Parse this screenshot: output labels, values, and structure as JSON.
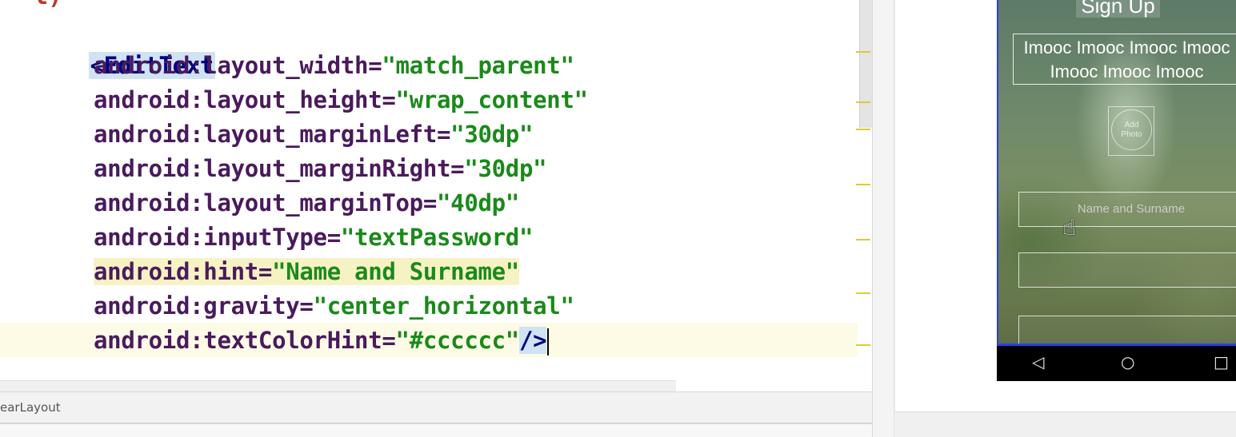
{
  "editor": {
    "partial_previous_line": "l)",
    "tag_open": "<EditText",
    "lines": [
      {
        "prefix": "android:",
        "name": "layout_width",
        "value": "\"match_parent\""
      },
      {
        "prefix": "android:",
        "name": "layout_height",
        "value": "\"wrap_content\""
      },
      {
        "prefix": "android:",
        "name": "layout_marginLeft",
        "value": "\"30dp\""
      },
      {
        "prefix": "android:",
        "name": "layout_marginRight",
        "value": "\"30dp\""
      },
      {
        "prefix": "android:",
        "name": "layout_marginTop",
        "value": "\"40dp\""
      },
      {
        "prefix": "android:",
        "name": "inputType",
        "value": "\"textPassword\""
      },
      {
        "prefix": "android:",
        "name": "hint",
        "value": "\"Name and Surname\""
      },
      {
        "prefix": "android:",
        "name": "gravity",
        "value": "\"center_horizontal\""
      },
      {
        "prefix": "android:",
        "name": "textColorHint",
        "value": "\"#cccccc\""
      }
    ],
    "tag_close": "/>",
    "breadcrumb": "earLayout"
  },
  "preview": {
    "title": "Sign Up",
    "mooc_line1": "Imooc Imooc Imooc Imooc",
    "mooc_line2": "Imooc Imooc Imooc",
    "photo_line1": "Add",
    "photo_line2": "Photo",
    "field_hint": "Name and Surname",
    "nav_back": "◁",
    "nav_home": "○",
    "nav_recent": "□"
  },
  "colors": {
    "tag": "#000080",
    "attribute": "#4a1a5c",
    "string": "#1a8a1a",
    "hint_text": "#cccccc",
    "device_border": "#2a3cff"
  }
}
